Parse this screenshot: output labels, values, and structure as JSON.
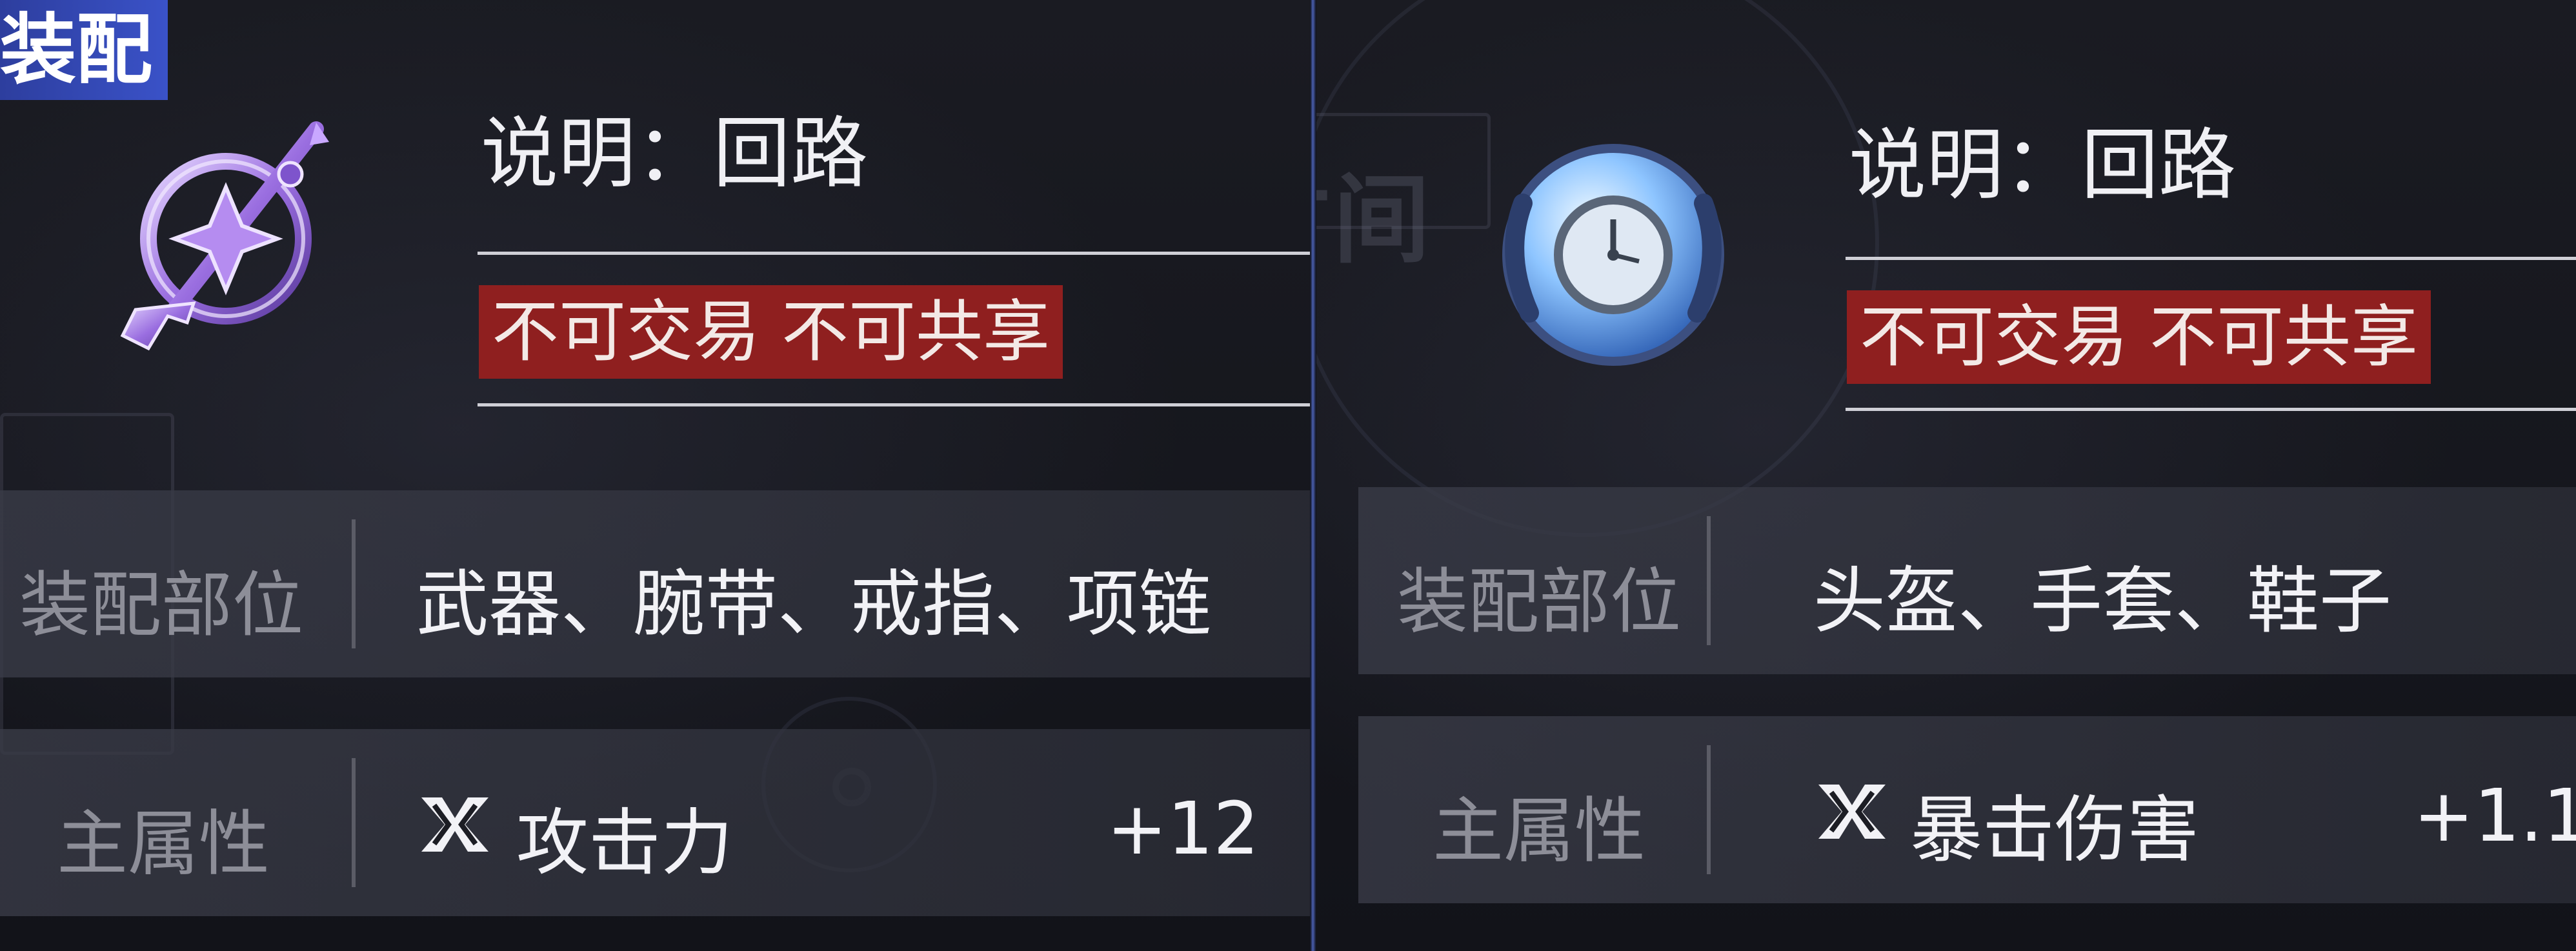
{
  "left_card": {
    "category_tag": "装配",
    "description": "说明：回路",
    "restriction": "不可交易 不可共享",
    "slots_label": "装配部位",
    "slots_value": "武器、腕带、戒指、项链",
    "stat_label": "主属性",
    "stat_name": "攻击力",
    "stat_value": "+12",
    "icon": "purple-key-icon"
  },
  "right_card": {
    "description": "说明：回路",
    "restriction": "不可交易 不可共享",
    "slots_label": "装配部位",
    "slots_value": "头盔、手套、鞋子",
    "stat_label": "主属性",
    "stat_name": "暴击伤害",
    "stat_value": "+1.1",
    "icon": "blue-clock-orb-icon"
  },
  "colors": {
    "restriction_bg": "#8f1f1f",
    "tag_bg": "#3a52c8",
    "row_bg": "#3a3c48"
  }
}
